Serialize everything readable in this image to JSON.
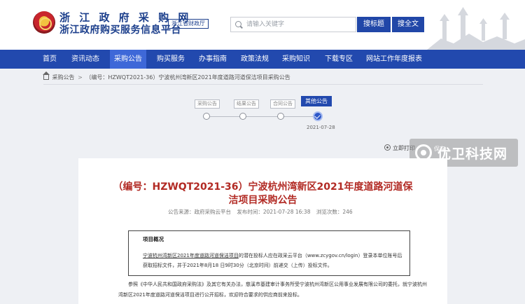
{
  "header": {
    "site_title": "浙 江 政 府 采 购 网",
    "site_subtitle": "浙江政府购买服务信息平台",
    "dept_badge": "浙江省财政厅",
    "search_placeholder": "请输入关键字",
    "btn_search_title": "搜标题",
    "btn_search_full": "搜全文"
  },
  "nav": {
    "items": [
      "首页",
      "资讯动态",
      "采购公告",
      "购买服务",
      "办事指南",
      "政策法规",
      "采购知识",
      "下载专区",
      "网站工作年度报表"
    ],
    "active_index": 2
  },
  "breadcrumb": {
    "root": "采购公告",
    "separator": ">",
    "current": "（编号：HZWQT2021-36）宁波杭州湾新区2021年度道路河道保洁项目采购公告"
  },
  "stepper": {
    "steps": [
      "采购公告",
      "结果公告",
      "合同公告",
      "其他公告"
    ],
    "active_index": 3,
    "date": "2021-07-28"
  },
  "tools": {
    "print_label": "立即打印",
    "save_label": "保存"
  },
  "watermark": {
    "text": "优卫科技网"
  },
  "doc": {
    "title_line1": "（编号：HZWQT2021-36）宁波杭州湾新区2021年度道路河道保",
    "title_line2": "洁项目采购公告",
    "source": "公告来源：政府采购云平台",
    "publish_time": "发布时间：2021-07-28 16:38",
    "views": "浏览次数：246",
    "notice_head": "项目概况",
    "notice_part1": "宁波杭州湾新区2021年度道路河道保洁项目",
    "notice_part2": "的潜在投标人应在政采云平台（www.zcygov.cn/login）登录本单位账号后获取招标文件，并于2021年8月18 日9时30分（北京时间）前递交（上传）投标文件。",
    "paragraph": "参照《中华人民共和国政府采购法》及其它有关办法，慈溪市基建审计事务所受宁波杭州湾新区公用事业发展有限公司的委托，就宁波杭州湾新区2021年度道路河道保洁项目进行公开招标，欢迎符合要求的供应商前来投标。"
  },
  "colors": {
    "brand_blue": "#2249ae",
    "nav_active": "#3e68d8",
    "title_red": "#b22a24"
  }
}
